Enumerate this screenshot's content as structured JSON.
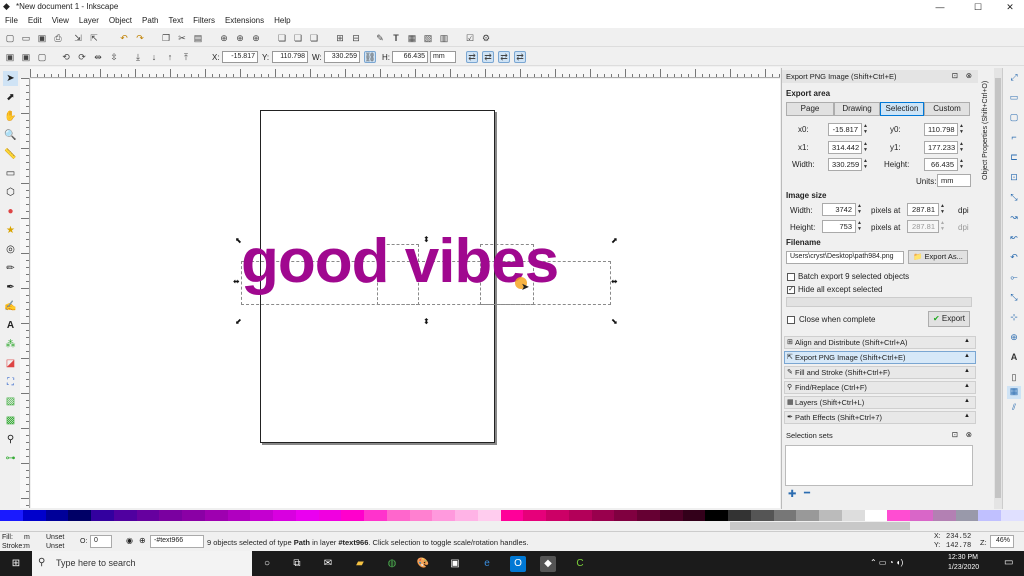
{
  "window": {
    "title": "*New document 1 - Inkscape",
    "min": "—",
    "max": "☐",
    "close": "✕"
  },
  "menu": [
    "File",
    "Edit",
    "View",
    "Layer",
    "Object",
    "Path",
    "Text",
    "Filters",
    "Extensions",
    "Help"
  ],
  "coords": {
    "x_label": "X:",
    "x": "-15.817",
    "y_label": "Y:",
    "y": "110.798",
    "w_label": "W:",
    "w": "330.259",
    "h_label": "H:",
    "h": "66.435",
    "unit": "mm"
  },
  "artwork": {
    "text": "good vibes",
    "color": "#a0088f"
  },
  "export_panel": {
    "title": "Export PNG Image (Shift+Ctrl+E)",
    "export_area": "Export area",
    "area_buttons": [
      "Page",
      "Drawing",
      "Selection",
      "Custom"
    ],
    "selected_area": "Selection",
    "x0_label": "x0:",
    "x0": "-15.817",
    "y0_label": "y0:",
    "y0": "110.798",
    "x1_label": "x1:",
    "x1": "314.442",
    "y1_label": "y1:",
    "y1": "177.233",
    "width_label": "Width:",
    "width": "330.259",
    "height_label": "Height:",
    "height": "66.435",
    "units_label": "Units:",
    "units": "mm",
    "image_size": "Image size",
    "img_width_label": "Width:",
    "img_width": "3742",
    "img_height_label": "Height:",
    "img_height": "753",
    "pixels_at": "pixels at",
    "dpi_x": "287.81",
    "dpi_y": "287.81",
    "dpi_label": "dpi",
    "filename_label": "Filename",
    "filename": "Users\\cryst\\Desktop\\path984.png",
    "export_as": "Export As...",
    "batch_label": "Batch export 9 selected objects",
    "hide_label": "Hide all except selected",
    "close_label": "Close when complete",
    "export_button": "Export"
  },
  "docked": [
    {
      "label": "Align and Distribute (Shift+Ctrl+A)",
      "active": false
    },
    {
      "label": "Export PNG Image (Shift+Ctrl+E)",
      "active": true
    },
    {
      "label": "Fill and Stroke (Shift+Ctrl+F)",
      "active": false
    },
    {
      "label": "Find/Replace (Ctrl+F)",
      "active": false
    },
    {
      "label": "Layers (Shift+Ctrl+L)",
      "active": false
    },
    {
      "label": "Path Effects  (Shift+Ctrl+7)",
      "active": false
    }
  ],
  "selection_sets": "Selection sets",
  "object_properties_tab": "Object Properties (Shift+Ctrl+O)",
  "status": {
    "fill_label": "Fill:",
    "fill_value": "m",
    "fill_unset": "Unset",
    "stroke_label": "Stroke:",
    "stroke_value": "m",
    "stroke_unset": "Unset",
    "opacity_label": "O:",
    "opacity": "0",
    "layer": "-#text966",
    "message_pre": "9 objects selected of type ",
    "message_type": "Path",
    "message_mid": " in layer ",
    "message_layer": "#text966",
    "message_post": ". Click selection to toggle scale/rotation handles.",
    "cursor_x_label": "X:",
    "cursor_x": "234.52",
    "cursor_y_label": "Y:",
    "cursor_y": "142.78",
    "zoom_label": "Z:",
    "zoom": "46%"
  },
  "taskbar": {
    "search_placeholder": "Type here to search",
    "time": "12:30 PM",
    "date": "1/23/2020"
  },
  "palette_colors": [
    "#1a1aff",
    "#0000cc",
    "#000099",
    "#000066",
    "#33009f",
    "#5000a0",
    "#66009f",
    "#7a00a0",
    "#8a00a5",
    "#9e00b0",
    "#b000c0",
    "#c400d0",
    "#d800e0",
    "#ea00f0",
    "#f000e0",
    "#ff00cc",
    "#ff33cc",
    "#ff66cc",
    "#ff80d0",
    "#ff99dd",
    "#ffb3e6",
    "#ffccee",
    "#ff0099",
    "#e6007a",
    "#cc0066",
    "#b30059",
    "#99004d",
    "#800040",
    "#660033",
    "#4d0026",
    "#33001a",
    "#000000",
    "#333333",
    "#555555",
    "#777777",
    "#999999",
    "#bbbbbb",
    "#dddddd",
    "#ffffff",
    "#ff4dd2",
    "#d966c8",
    "#b380b3",
    "#9999aa",
    "#c0c0ff",
    "#e0e0ff"
  ]
}
